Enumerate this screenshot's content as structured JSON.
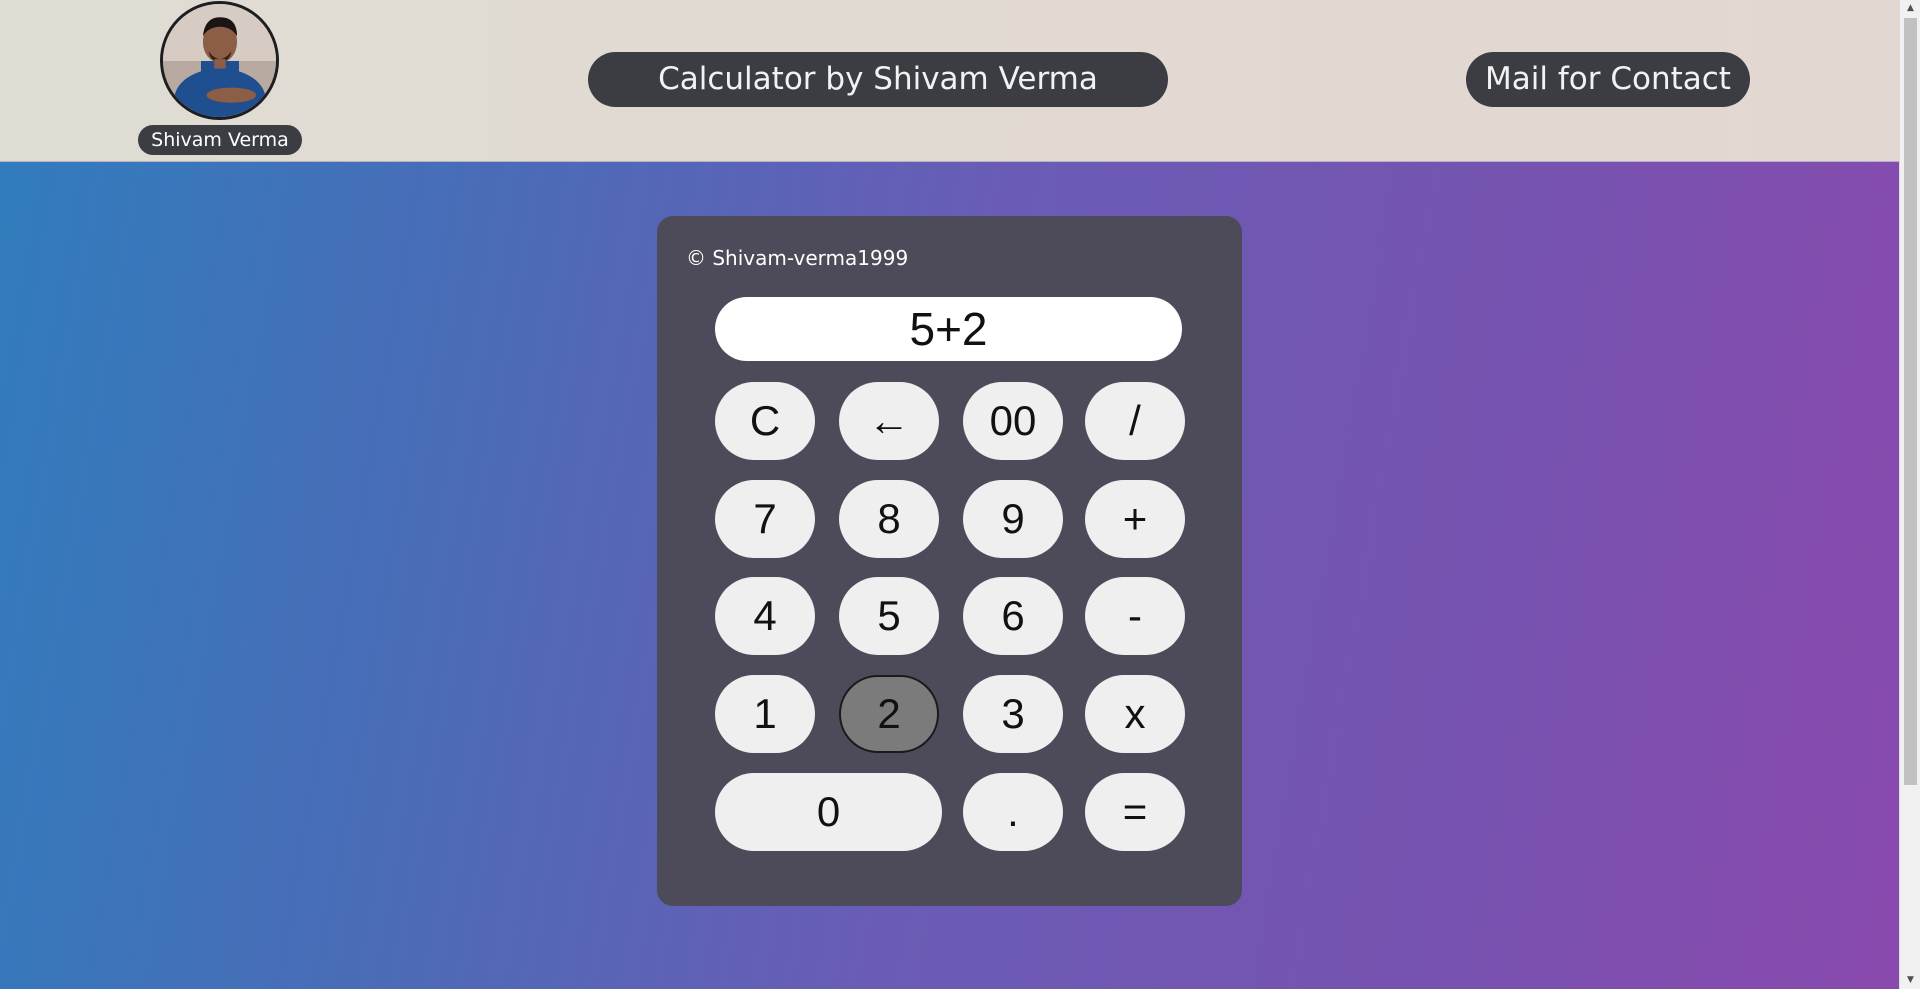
{
  "header": {
    "profile_name": "Shivam Verma",
    "title": "Calculator by Shivam Verma",
    "contact_label": "Mail for Contact"
  },
  "calculator": {
    "copyright": "© Shivam-verma1999",
    "display_value": "5+2",
    "keys": {
      "clear": "C",
      "backspace": "←",
      "double_zero": "00",
      "divide": "/",
      "seven": "7",
      "eight": "8",
      "nine": "9",
      "plus": "+",
      "four": "4",
      "five": "5",
      "six": "6",
      "minus": "-",
      "one": "1",
      "two": "2",
      "three": "3",
      "multiply": "x",
      "zero": "0",
      "decimal": ".",
      "equals": "="
    },
    "active_key": "two"
  },
  "icons": {
    "avatar": "profile-photo",
    "scroll_up": "triangle-up-icon",
    "scroll_down": "triangle-down-icon"
  },
  "colors": {
    "header_bg": "#dfdcd3",
    "pill_bg": "#3b3d42",
    "calc_bg": "#4d4b59",
    "key_bg": "#efefef",
    "key_active_bg": "#7b7b7b",
    "gradient_start": "#2f7dbd",
    "gradient_end": "#8a49ad"
  }
}
